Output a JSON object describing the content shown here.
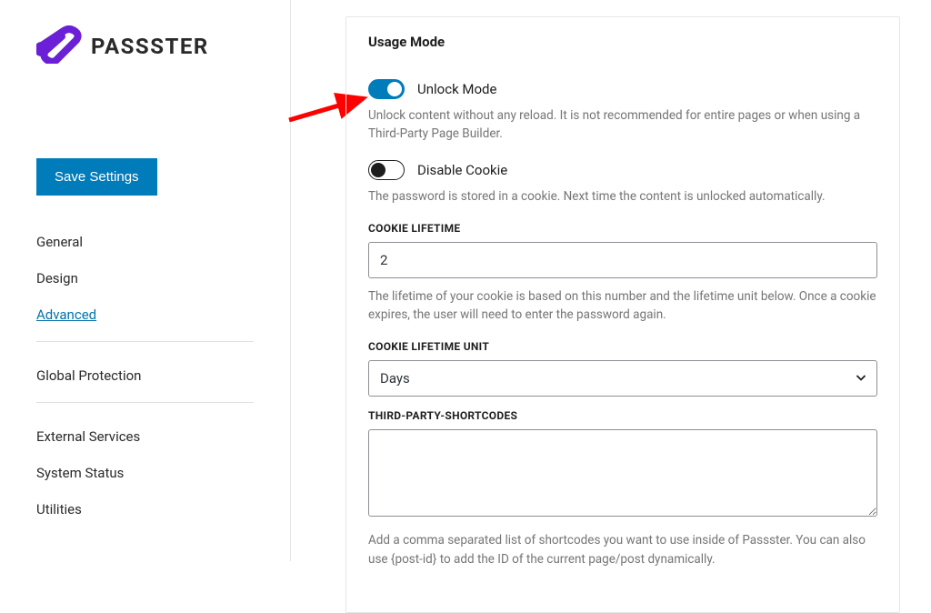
{
  "brand": {
    "name": "PASSSTER"
  },
  "sidebar": {
    "save_label": "Save Settings",
    "groups": [
      {
        "items": [
          {
            "label": "General",
            "active": false
          },
          {
            "label": "Design",
            "active": false
          },
          {
            "label": "Advanced",
            "active": true
          }
        ]
      },
      {
        "items": [
          {
            "label": "Global Protection",
            "active": false
          }
        ]
      },
      {
        "items": [
          {
            "label": "External Services",
            "active": false
          },
          {
            "label": "System Status",
            "active": false
          },
          {
            "label": "Utilities",
            "active": false
          }
        ]
      }
    ]
  },
  "card": {
    "title": "Usage Mode",
    "unlock": {
      "label": "Unlock Mode",
      "on": true,
      "help": "Unlock content without any reload. It is not recommended for entire pages or when using a Third-Party Page Builder."
    },
    "disable_cookie": {
      "label": "Disable Cookie",
      "on": false,
      "help": "The password is stored in a cookie. Next time the content is unlocked automatically."
    },
    "cookie_lifetime": {
      "label": "COOKIE LIFETIME",
      "value": "2",
      "help": "The lifetime of your cookie is based on this number and the lifetime unit below. Once a cookie expires, the user will need to enter the password again."
    },
    "cookie_unit": {
      "label": "COOKIE LIFETIME UNIT",
      "value": "Days"
    },
    "shortcodes": {
      "label": "THIRD-PARTY-SHORTCODES",
      "value": "",
      "help": "Add a comma separated list of shortcodes you want to use inside of Passster. You can also use {post-id} to add the ID of the current page/post dynamically."
    }
  }
}
